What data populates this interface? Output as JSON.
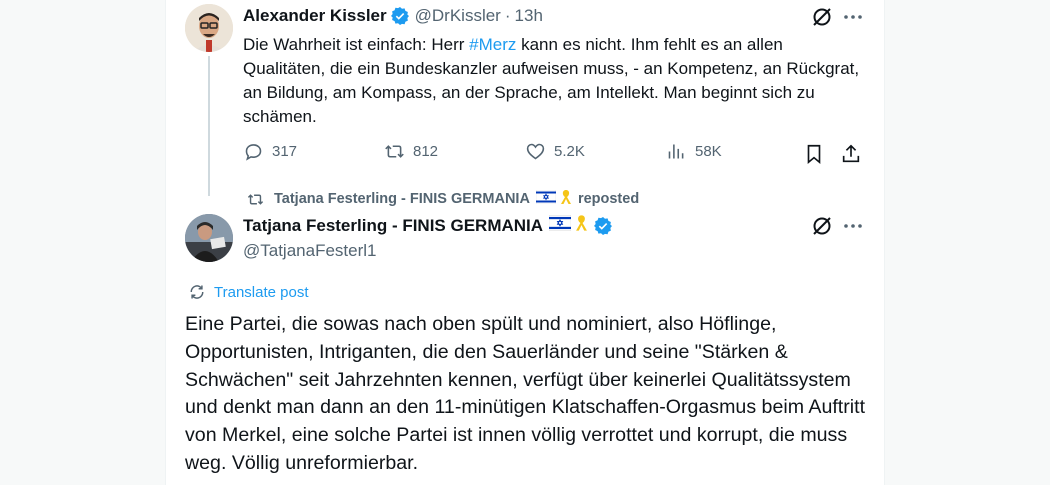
{
  "tweet1": {
    "author_name": "Alexander Kissler",
    "handle": "@DrKissler",
    "separator": "·",
    "time": "13h",
    "text_before": "Die Wahrheit ist einfach: Herr ",
    "hashtag": "#Merz",
    "text_after": " kann es nicht. Ihm fehlt es an allen Qualitäten, die ein Bundeskanzler aufweisen muss, - an Kompetenz, an Rückgrat, an Bildung, am Kompass, an der Sprache, am Intellekt. Man beginnt sich zu schämen.",
    "replies": "317",
    "reposts": "812",
    "likes": "5.2K",
    "views": "58K"
  },
  "repost_banner": {
    "name": "Tatjana Festerling - FINIS GERMANIA",
    "label": "reposted"
  },
  "tweet2": {
    "author_name": "Tatjana Festerling - FINIS GERMANIA",
    "handle": "@TatjanaFesterl1",
    "translate_label": "Translate post",
    "text": "Eine Partei, die sowas nach oben spült und nominiert, also Höflinge, Opportunisten, Intriganten, die den Sauerländer und seine \"Stärken & Schwächen\" seit Jahrzehnten kennen, verfügt über keinerlei Qualitätssystem und denkt man dann an den 11-minütigen Klatschaffen-Orgasmus beim Auftritt von Merkel, eine solche Partei ist innen völlig verrottet und korrupt, die muss weg. Völlig unreformierbar."
  },
  "colors": {
    "accent": "#1d9bf0",
    "muted": "#536471",
    "text": "#0f1419"
  },
  "icons": [
    "verified-badge-icon",
    "grok-icon",
    "more-icon",
    "reply-icon",
    "repost-icon",
    "like-icon",
    "views-icon",
    "bookmark-icon",
    "share-icon",
    "translate-icon",
    "israel-flag-icon",
    "yellow-ribbon-icon"
  ]
}
